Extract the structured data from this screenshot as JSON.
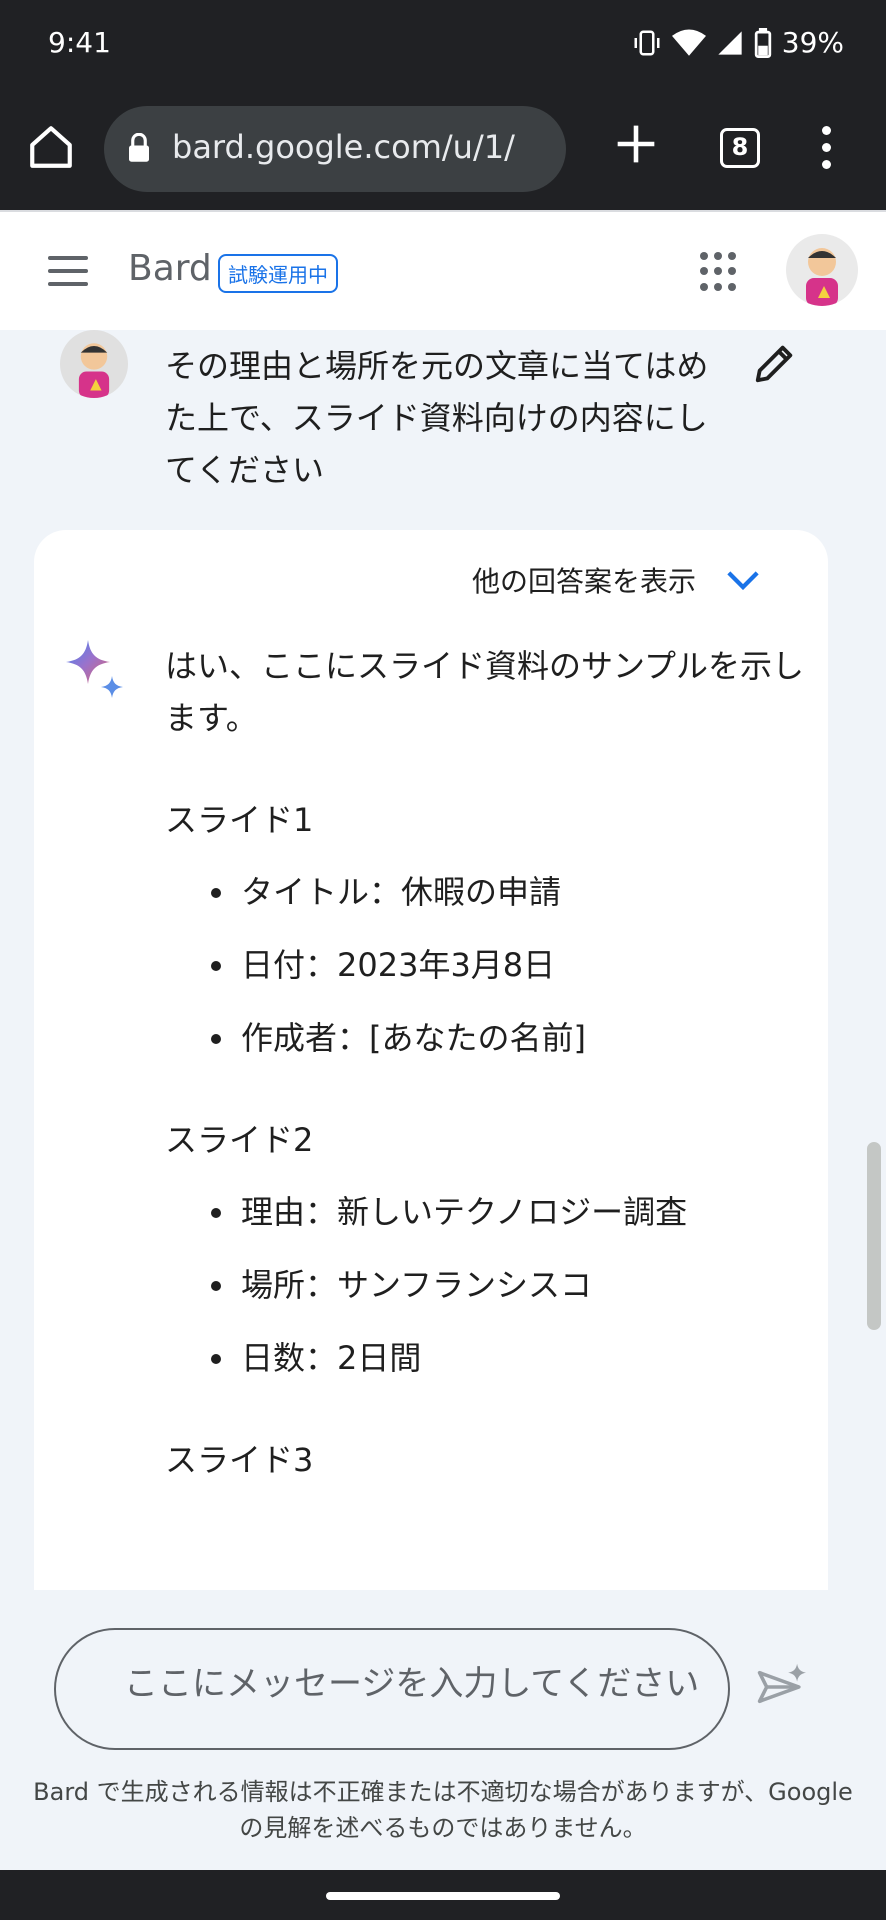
{
  "status_bar": {
    "time": "9:41",
    "battery": "39%"
  },
  "browser": {
    "url": "bard.google.com/u/1/",
    "tab_count": "8"
  },
  "app_header": {
    "logo": "Bard",
    "badge": "試験運用中"
  },
  "conversation": {
    "user_message": "その理由と場所を元の文章に当てはめた上で、スライド資料向けの内容にしてください",
    "show_drafts_label": "他の回答案を表示",
    "response": {
      "intro": "はい、ここにスライド資料のサンプルを示します。",
      "slides": [
        {
          "title": "スライド1",
          "items": [
            "タイトル：休暇の申請",
            "日付：2023年3月8日",
            "作成者：[あなたの名前]"
          ]
        },
        {
          "title": "スライド2",
          "items": [
            "理由：新しいテクノロジー調査",
            "場所：サンフランシスコ",
            "日数：2日間"
          ]
        },
        {
          "title": "スライド3",
          "items": []
        }
      ]
    }
  },
  "input": {
    "placeholder": "ここにメッセージを入力してください"
  },
  "disclaimer": "Bard で生成される情報は不正確または不適切な場合がありますが、Google の見解を述べるものではありません。",
  "colors": {
    "accent": "#1a73e8",
    "system_bar": "#202124",
    "page_background": "#f0f4f9"
  }
}
